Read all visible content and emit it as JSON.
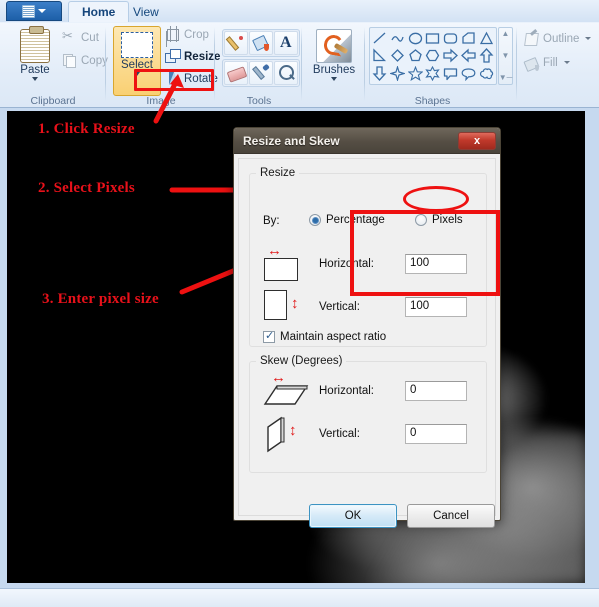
{
  "app": {
    "menu_button": "paint-menu-button",
    "tabs": [
      {
        "label": "Home",
        "active": true
      },
      {
        "label": "View",
        "active": false
      }
    ]
  },
  "ribbon": {
    "groups": [
      {
        "title": "Clipboard",
        "items": [
          {
            "label": "Paste",
            "icon": "clipboard-icon",
            "has_dropdown": true,
            "enabled": true
          },
          {
            "label": "Cut",
            "icon": "scissors-icon",
            "enabled": false
          },
          {
            "label": "Copy",
            "icon": "copy-icon",
            "enabled": false
          }
        ]
      },
      {
        "title": "Image",
        "items": [
          {
            "label": "Select",
            "icon": "selection-marquee-icon",
            "has_dropdown": true,
            "enabled": true,
            "highlighted": true
          },
          {
            "label": "Crop",
            "icon": "crop-icon",
            "enabled": false
          },
          {
            "label": "Resize",
            "icon": "resize-icon",
            "enabled": true,
            "annotated": true
          },
          {
            "label": "Rotate",
            "icon": "rotate-icon",
            "has_dropdown": true,
            "enabled": true
          }
        ]
      },
      {
        "title": "Tools",
        "items": [
          {
            "icon": "pencil-icon"
          },
          {
            "icon": "fill-bucket-icon"
          },
          {
            "icon": "text-tool-icon"
          },
          {
            "icon": "eraser-icon"
          },
          {
            "icon": "color-picker-icon"
          },
          {
            "icon": "magnifier-icon"
          }
        ]
      },
      {
        "title": "Brushes",
        "items": [
          {
            "label": "Brushes",
            "icon": "brush-icon",
            "has_dropdown": true
          }
        ]
      },
      {
        "title": "Shapes",
        "shapes": [
          "line",
          "curve",
          "oval",
          "rectangle",
          "rounded-rectangle",
          "polygon",
          "triangle",
          "right-triangle",
          "diamond",
          "pentagon",
          "hexagon",
          "right-arrow",
          "left-arrow",
          "up-arrow",
          "down-arrow",
          "four-point-star",
          "five-point-star",
          "six-point-star",
          "rectangular-callout",
          "rounded-callout",
          "cloud-callout"
        ],
        "scroll": {
          "up": "scroll-up-arrow",
          "down": "scroll-down-arrow",
          "more": "more-shapes-arrow"
        }
      },
      {
        "title": "",
        "items": [
          {
            "label": "Outline",
            "icon": "outline-icon",
            "has_dropdown": true,
            "enabled": false
          },
          {
            "label": "Fill",
            "icon": "fill-icon",
            "has_dropdown": true,
            "enabled": false
          }
        ]
      }
    ]
  },
  "annotations": [
    {
      "id": "step-1",
      "text": "1. Click Resize"
    },
    {
      "id": "step-2",
      "text": "2. Select Pixels"
    },
    {
      "id": "step-3",
      "text": "3. Enter pixel size"
    }
  ],
  "dialog": {
    "title": "Resize and Skew",
    "close_label": "x",
    "resize": {
      "legend": "Resize",
      "by_label": "By:",
      "options": [
        {
          "label": "Percentage",
          "selected": true
        },
        {
          "label": "Pixels",
          "selected": false
        }
      ],
      "horizontal_label": "Horizontal:",
      "horizontal_value": "100",
      "vertical_label": "Vertical:",
      "vertical_value": "100",
      "maintain_label": "Maintain aspect ratio",
      "maintain_checked": true,
      "horizontal_icon": "horizontal-resize-icon",
      "vertical_icon": "vertical-resize-icon"
    },
    "skew": {
      "legend": "Skew (Degrees)",
      "horizontal_label": "Horizontal:",
      "horizontal_value": "0",
      "vertical_label": "Vertical:",
      "vertical_value": "0",
      "horizontal_icon": "horizontal-skew-icon",
      "vertical_icon": "vertical-skew-icon"
    },
    "buttons": {
      "ok": "OK",
      "cancel": "Cancel"
    }
  },
  "colors": {
    "annotation_red": "#ee1111",
    "highlight_orange": "#f9d073",
    "accent_blue": "#2d6ca8",
    "canvas_black": "#000000",
    "title_bar": "#554e44",
    "close_red": "#c0392b"
  }
}
